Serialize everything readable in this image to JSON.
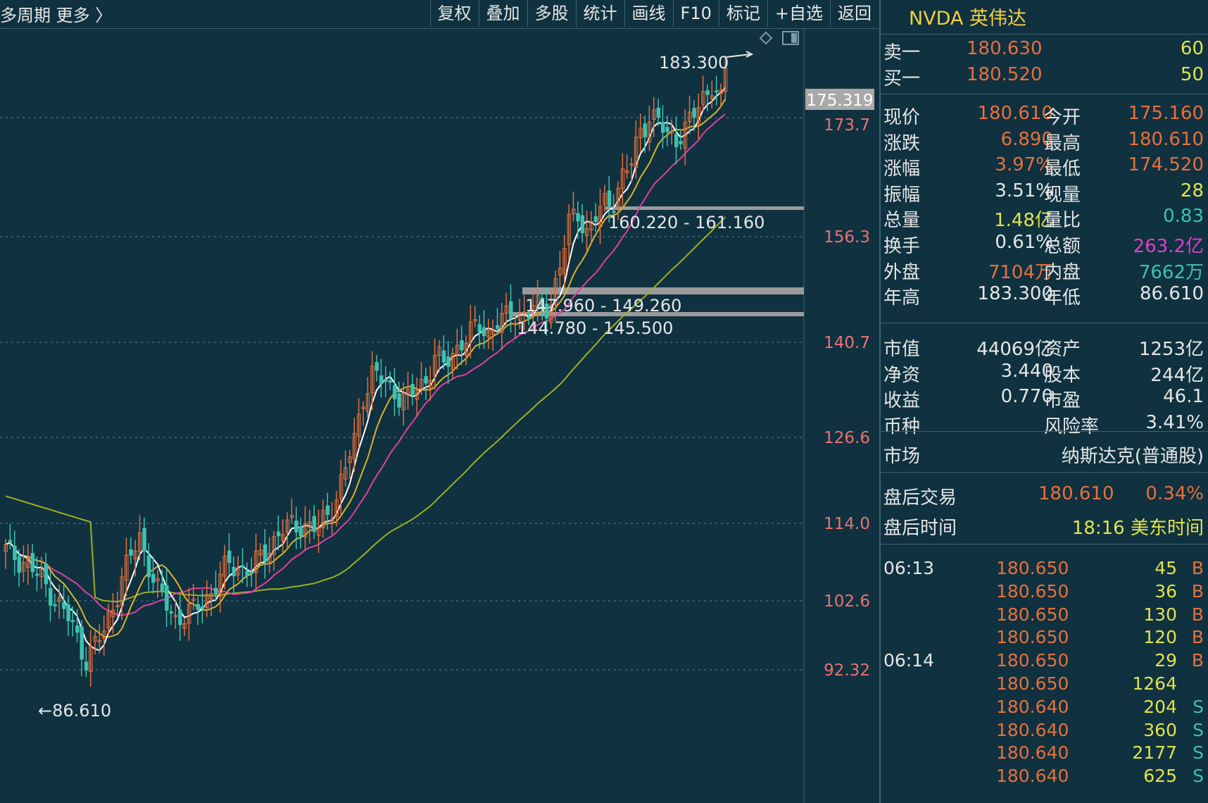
{
  "toolbar": {
    "left_label": "多周期  更多 〉",
    "buttons": [
      "复权",
      "叠加",
      "多股",
      "统计",
      "画线",
      "F10",
      "标记",
      "+自选",
      "返回"
    ]
  },
  "chart": {
    "price_axis": [
      "175.319",
      "173.7",
      "156.3",
      "140.7",
      "126.6",
      "114.0",
      "102.6",
      "92.32"
    ],
    "current_price_tag": "175.319",
    "annotations": {
      "high": "183.300",
      "low": "←86.610",
      "zone1": "160.220 - 161.160",
      "zone2": "147.960 - 149.260",
      "zone3": "144.780 - 145.500"
    },
    "colors": {
      "up": "#e8703a",
      "down": "#3fc1b0",
      "ma5": "#ffffff",
      "ma10": "#d9b429",
      "ma20": "#e040a0",
      "ma60": "#9fb020"
    }
  },
  "panel": {
    "title": "NVDA 英伟达",
    "ask": {
      "label": "卖一",
      "price": "180.630",
      "vol": "60"
    },
    "bid": {
      "label": "买一",
      "price": "180.520",
      "vol": "50"
    },
    "stats": [
      [
        "现价",
        "180.610",
        "今开",
        "175.160"
      ],
      [
        "涨跌",
        "6.890",
        "最高",
        "180.610"
      ],
      [
        "涨幅",
        "3.97%",
        "最低",
        "174.520"
      ],
      [
        "振幅",
        "3.51%",
        "现量",
        "28"
      ],
      [
        "总量",
        "1.48亿",
        "量比",
        "0.83"
      ],
      [
        "换手",
        "0.61%",
        "总额",
        "263.2亿"
      ],
      [
        "外盘",
        "7104万",
        "内盘",
        "7662万"
      ],
      [
        "年高",
        "183.300",
        "年低",
        "86.610"
      ]
    ],
    "fundamentals": [
      [
        "市值",
        "44069亿",
        "资产",
        "1253亿"
      ],
      [
        "净资",
        "3.440",
        "股本",
        "244亿"
      ],
      [
        "收益",
        "0.770",
        "市盈",
        "46.1"
      ],
      [
        "币种",
        "",
        "风险率",
        "3.41%"
      ]
    ],
    "market": {
      "label": "市场",
      "value": "纳斯达克(普通股)"
    },
    "after_hours": {
      "label": "盘后交易",
      "price": "180.610",
      "pct": "0.34%"
    },
    "after_time": {
      "label": "盘后时间",
      "value": "18:16 美东时间"
    },
    "ticks": [
      {
        "time": "06:13",
        "price": "180.650",
        "vol": "45",
        "side": "B"
      },
      {
        "time": "",
        "price": "180.650",
        "vol": "36",
        "side": "B"
      },
      {
        "time": "",
        "price": "180.650",
        "vol": "130",
        "side": "B"
      },
      {
        "time": "",
        "price": "180.650",
        "vol": "120",
        "side": "B"
      },
      {
        "time": "06:14",
        "price": "180.650",
        "vol": "29",
        "side": "B"
      },
      {
        "time": "",
        "price": "180.650",
        "vol": "1264",
        "side": ""
      },
      {
        "time": "",
        "price": "180.640",
        "vol": "204",
        "side": "S"
      },
      {
        "time": "",
        "price": "180.640",
        "vol": "360",
        "side": "S"
      },
      {
        "time": "",
        "price": "180.640",
        "vol": "2177",
        "side": "S"
      },
      {
        "time": "",
        "price": "180.640",
        "vol": "625",
        "side": "S"
      }
    ]
  }
}
